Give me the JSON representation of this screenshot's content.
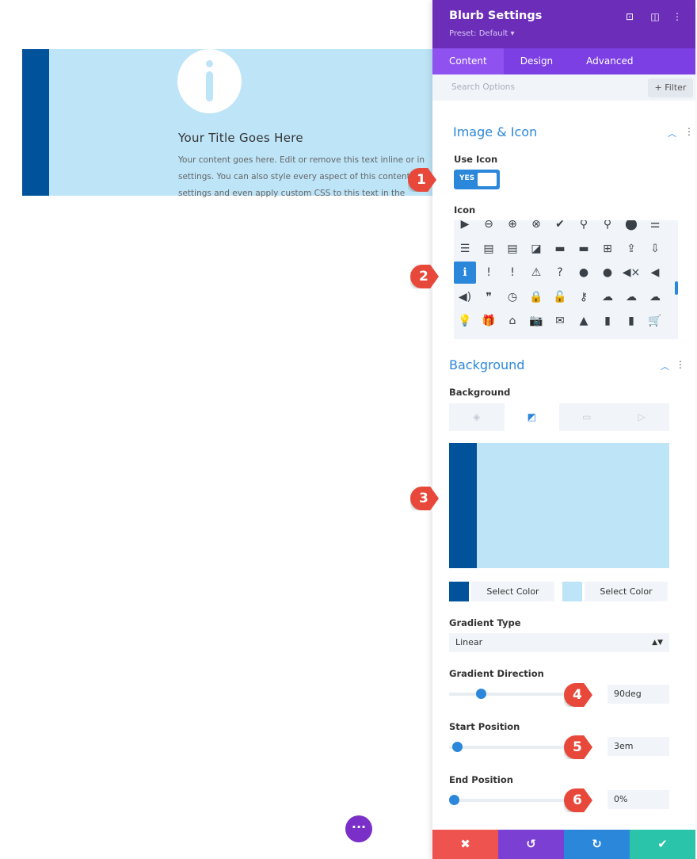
{
  "preview": {
    "title": "Your Title Goes Here",
    "lines": [
      "Your content goes here. Edit or remove this text inline or in",
      "settings. You can also style every aspect of this content",
      "settings and even apply custom CSS to this text in the"
    ],
    "icon": "info-icon"
  },
  "panel": {
    "title": "Blurb Settings",
    "preset": "Preset: Default ▾",
    "header_icons": [
      "focus-icon",
      "split-view-icon",
      "more-icon"
    ],
    "tabs": [
      {
        "label": "Content",
        "active": true
      },
      {
        "label": "Design"
      },
      {
        "label": "Advanced"
      }
    ],
    "search_placeholder": "Search Options",
    "filter_label": "+ Filter",
    "image_icon": {
      "title": "Image & Icon",
      "use_icon_label": "Use Icon",
      "toggle": "YES",
      "icon_label": "Icon",
      "icons": [
        "▶",
        "⊖",
        "⊕",
        "⊗",
        "✔",
        "⚲",
        "⚲",
        "⬤",
        "☰",
        "☰",
        "▤",
        "▤",
        "◪",
        "▬",
        "▬",
        "⊞",
        "⇪",
        "⇩",
        "ℹ",
        "!",
        "!",
        "⚠",
        "?",
        "●",
        "●",
        "◀×",
        "◀",
        "◀)",
        "❞",
        "◷",
        "🔒",
        "🔓",
        "⚷",
        "☁",
        "☁",
        "☁",
        "💡",
        "🎁",
        "⌂",
        "📷",
        "✉",
        "▲",
        "▮",
        "▮",
        "🛒"
      ],
      "selected_index": 18
    },
    "background": {
      "title": "Background",
      "label": "Background",
      "tabs": [
        "color-icon",
        "gradient-icon",
        "image-icon",
        "video-icon"
      ],
      "active_tab": 1,
      "color1": "#00529b",
      "color2": "#bde4f7",
      "select_color": "Select Color",
      "gradient_type_label": "Gradient Type",
      "gradient_type": "Linear",
      "direction_label": "Gradient Direction",
      "direction": "90deg",
      "direction_fraction": 0.25,
      "start_label": "Start Position",
      "start": "3em",
      "start_fraction": 0.03,
      "end_label": "End Position",
      "end": "0%",
      "end_fraction": 0
    }
  },
  "footer": {
    "cancel": "✖",
    "undo": "↺",
    "redo": "↻",
    "save": "✔"
  },
  "markers": [
    "1",
    "2",
    "3",
    "4",
    "5",
    "6"
  ],
  "colors": {
    "header": "#6c2eb9",
    "tabs": "#7b3fe4",
    "accent": "#2b87da",
    "cancel": "#ef5350",
    "undo": "#7b3fd4",
    "redo": "#2b87da",
    "save": "#29c4a9"
  }
}
